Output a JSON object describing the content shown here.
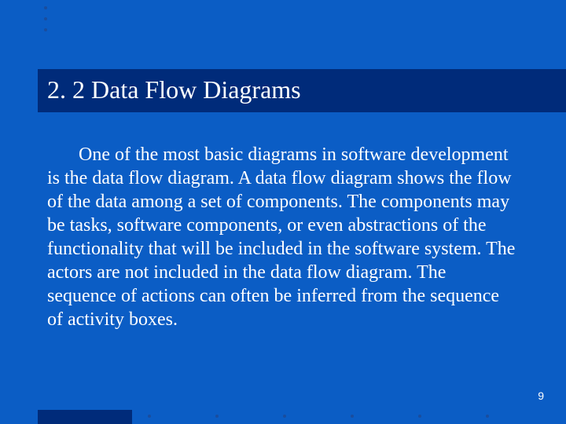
{
  "title": "2. 2 Data Flow Diagrams",
  "body": "One of the most basic diagrams in software development is the data flow diagram. A data flow diagram shows the flow of the data among a set of components. The components may be tasks, software components, or even abstractions of the functionality that will be included in the software system. The actors are not included in the data flow diagram. The sequence of actions can often be inferred from the sequence of activity boxes.",
  "page_number": "9"
}
